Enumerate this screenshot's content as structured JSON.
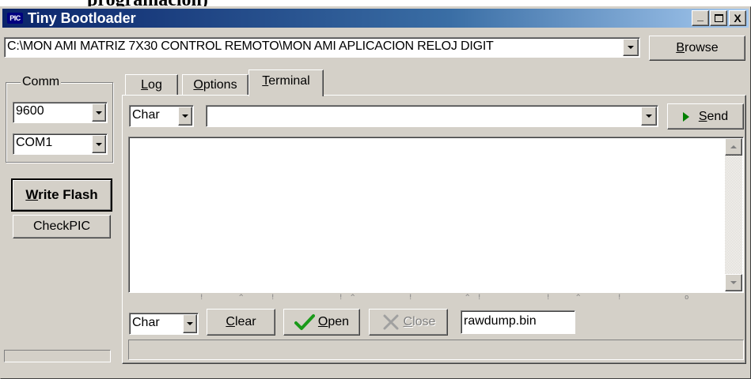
{
  "clipped_top_text": "programación)",
  "window": {
    "title": "Tiny Bootloader",
    "icon_label": "PIC",
    "min_glyph": "_",
    "max_glyph": "□",
    "close_glyph": "X"
  },
  "file_path": {
    "value": "C:\\MON AMI MATRIZ 7X30 CONTROL REMOTO\\MON AMI APLICACION RELOJ DIGIT"
  },
  "browse_button": {
    "label_u": "B",
    "label_rest": "rowse"
  },
  "comm": {
    "legend": "Comm",
    "baud": "9600",
    "port": "COM1"
  },
  "write_flash": {
    "label_u": "W",
    "label_rest": "rite Flash"
  },
  "check_pic": {
    "label": "CheckPIC"
  },
  "tabs": [
    {
      "u": "L",
      "rest": "og"
    },
    {
      "u": "O",
      "rest": "ptions"
    },
    {
      "u": "T",
      "rest": "erminal"
    }
  ],
  "terminal": {
    "send_mode": "Char",
    "send_value": "",
    "send_button": {
      "u": "S",
      "rest": "end"
    },
    "output_text": "",
    "recv_mode": "Char",
    "clear_button": {
      "u": "C",
      "rest": "lear"
    },
    "open_button": {
      "u": "O",
      "rest": "pen"
    },
    "close_button": {
      "u": "C",
      "rest": "lose"
    },
    "dump_file": "rawdump.bin"
  },
  "ruler_marks": [
    "!",
    "^",
    "!",
    "!",
    "^",
    "!",
    "^",
    "!",
    "!",
    "^",
    "!",
    "o"
  ],
  "status_text": "",
  "colors": {
    "title_gradient_start": "#0a246a",
    "title_gradient_end": "#a6caf0",
    "face": "#d4d0c8",
    "send_arrow": "#008000",
    "check_green": "#1a9a1a"
  }
}
